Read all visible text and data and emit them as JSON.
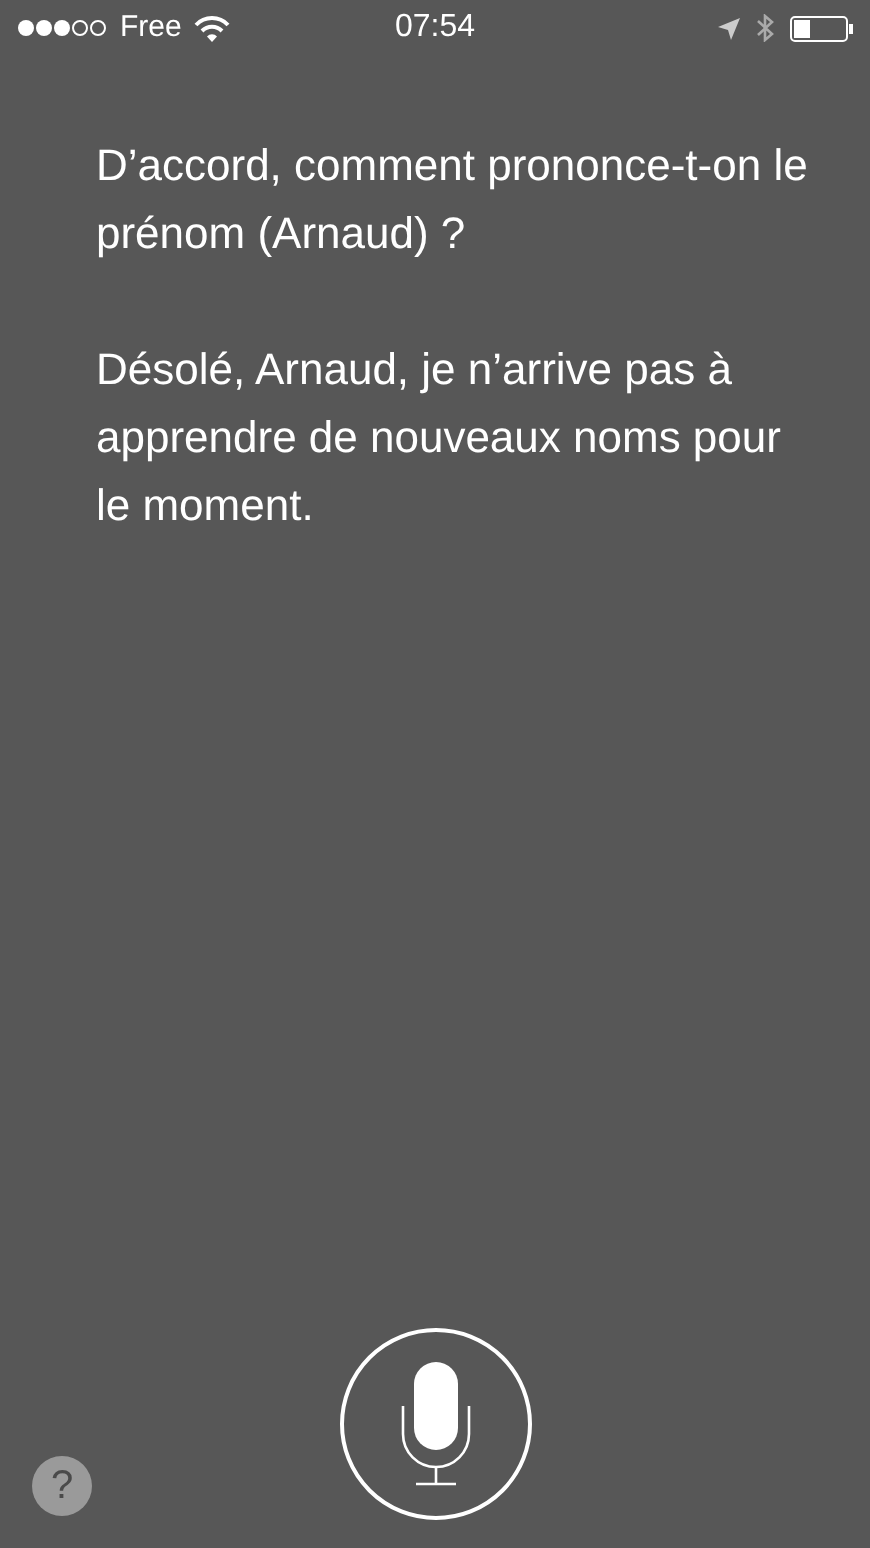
{
  "status_bar": {
    "carrier": "Free",
    "time": "07:54"
  },
  "messages": [
    "D’accord, comment prononce-t-on le prénom (Arnaud) ?",
    "Désolé, Arnaud, je n’arrive pas à apprendre de nouveaux noms pour le moment."
  ],
  "help_button": {
    "label": "?"
  }
}
